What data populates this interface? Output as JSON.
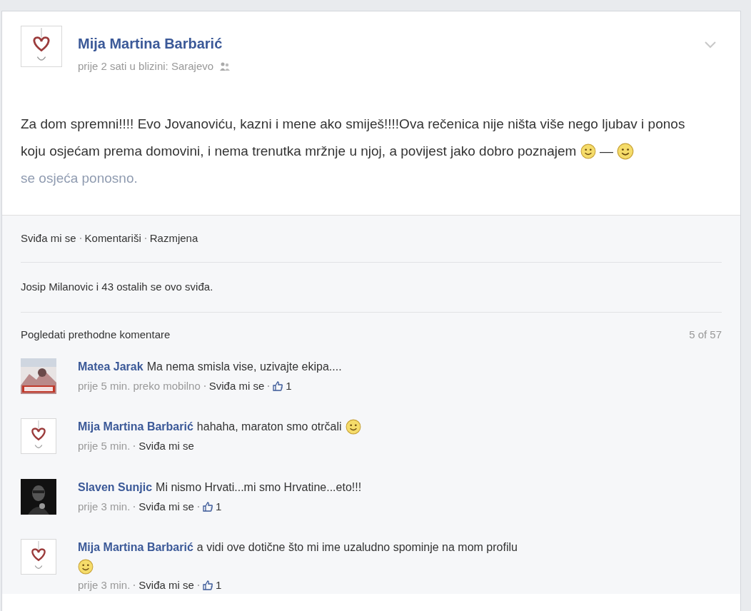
{
  "post": {
    "author": "Mija Martina Barbarić",
    "meta": "prije 2 sati u blizini: Sarajevo",
    "text": "Za dom spremni!!!! Evo Jovanoviću, kazni i mene ako smiješ!!!!Ova rečenica nije ništa više nego ljubav i ponos koju osjećam prema domovini, i nema trenutka mržnje u njoj, a povijest jako dobro poznajem",
    "dash": "—",
    "feeling": "se osjeća ponosno."
  },
  "actions": [
    "Sviđa mi se",
    "Komentariši",
    "Razmjena"
  ],
  "likes_summary": "Josip Milanovic i 43 ostalih se ovo sviđa.",
  "previous_comments": {
    "label": "Pogledati prethodne komentare",
    "count": "5 of 57"
  },
  "comments": [
    {
      "avatar": {
        "kind": "light_photo"
      },
      "author": "Matea Jarak",
      "text": "Ma nema smisla vise, uzivajte ekipa....",
      "time": "prije 5 min. preko mobilno",
      "like": "Sviđa mi se",
      "likes": "1"
    },
    {
      "avatar": {
        "kind": "heart"
      },
      "author": "Mija Martina Barbarić",
      "text": "hahaha, maraton smo otrčali",
      "emoji": {
        "kind": "inline"
      },
      "time": "prije 5 min.",
      "like": "Sviđa mi se"
    },
    {
      "avatar": {
        "kind": "dark_photo"
      },
      "author": "Slaven Sunjic",
      "text": "Mi nismo Hrvati...mi smo Hrvatine...eto!!!",
      "time": "prije 3 min.",
      "like": "Sviđa mi se",
      "likes": "1"
    },
    {
      "avatar": {
        "kind": "heart"
      },
      "author": "Mija Martina Barbarić",
      "text": "a vidi ove dotične što mi ime uzaludno spominje na mom profilu",
      "emoji": {
        "kind": "below"
      },
      "time": "prije 3 min.",
      "like": "Sviđa mi se",
      "likes": "1"
    }
  ]
}
